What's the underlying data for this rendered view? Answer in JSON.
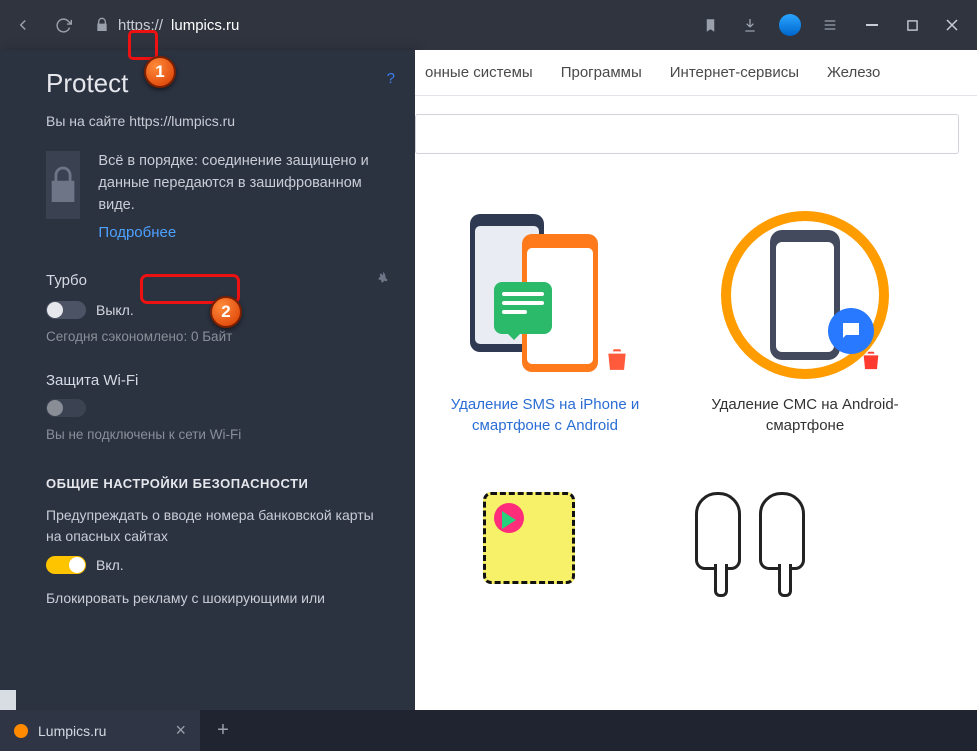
{
  "chrome": {
    "url_prefix": "https://",
    "url_host": "lumpics.ru"
  },
  "panel": {
    "title": "Protect",
    "help": "?",
    "site_prefix": "Вы на сайте ",
    "site_url": "https://lumpics.ru",
    "status": "Всё в порядке: соединение защищено и данные передаются в зашифрованном виде.",
    "more": "Подробнее",
    "turbo": {
      "label": "Турбо",
      "state": "Выкл.",
      "saved": "Сегодня сэкономлено: 0 Байт"
    },
    "wifi": {
      "label": "Защита Wi-Fi",
      "status": "Вы не подключены к сети Wi-Fi"
    },
    "sec_head": "ОБЩИЕ НАСТРОЙКИ БЕЗОПАСНОСТИ",
    "card_warn": "Предупреждать о вводе номера банковской карты на опасных сайтах",
    "card_state": "Вкл.",
    "adblock": "Блокировать рекламу с шокирующими или"
  },
  "nav": {
    "i1": "онные системы",
    "i2": "Программы",
    "i3": "Интернет-сервисы",
    "i4": "Железо"
  },
  "cards": {
    "c1": "Удаление SMS на iPhone и смартфоне с Android",
    "c2": "Удаление СМС на Android-смартфоне"
  },
  "tab": {
    "title": "Lumpics.ru"
  },
  "markers": {
    "m1": "1",
    "m2": "2"
  }
}
